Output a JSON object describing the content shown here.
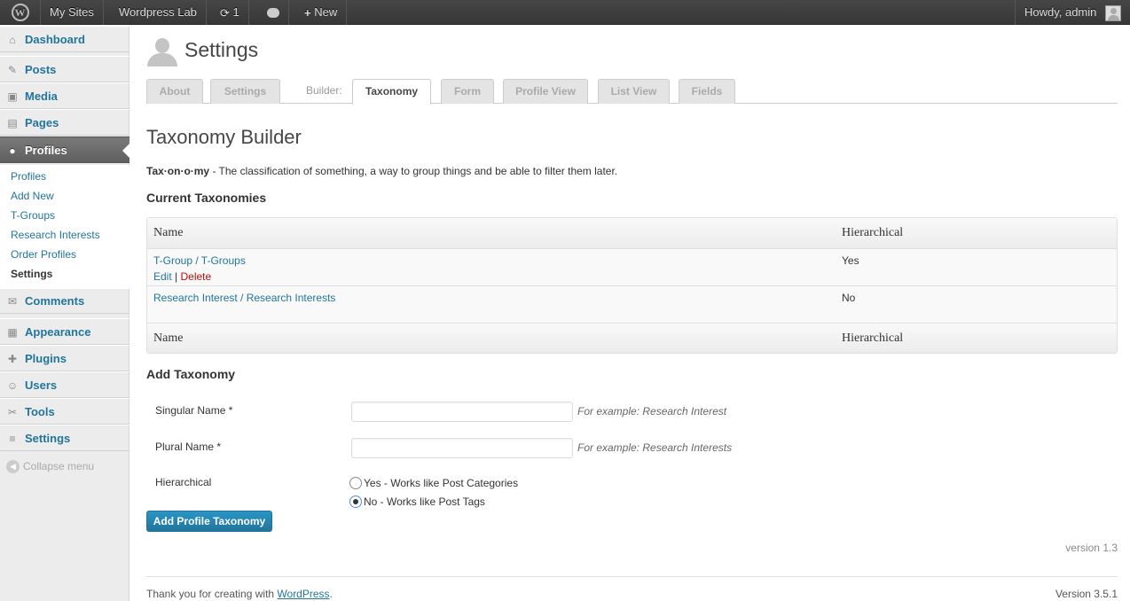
{
  "adminbar": {
    "logo": "W",
    "my_sites": "My Sites",
    "site_name": "Wordpress Lab",
    "updates_count": "1",
    "new_label": "New",
    "howdy": "Howdy, admin"
  },
  "sidebar": {
    "items": [
      {
        "label": "Dashboard",
        "icon": "⌂"
      },
      {
        "label": "Posts",
        "icon": "✎"
      },
      {
        "label": "Media",
        "icon": "▣"
      },
      {
        "label": "Pages",
        "icon": "▤"
      },
      {
        "label": "Profiles",
        "icon": "●"
      },
      {
        "label": "Comments",
        "icon": "✉"
      },
      {
        "label": "Appearance",
        "icon": "▦"
      },
      {
        "label": "Plugins",
        "icon": "✚"
      },
      {
        "label": "Users",
        "icon": "☺"
      },
      {
        "label": "Tools",
        "icon": "✂"
      },
      {
        "label": "Settings",
        "icon": "≡"
      }
    ],
    "submenu": [
      "Profiles",
      "Add New",
      "T-Groups",
      "Research Interests",
      "Order Profiles",
      "Settings"
    ],
    "collapse": "Collapse menu"
  },
  "page": {
    "title": "Settings",
    "tabs": [
      "About",
      "Settings",
      "Taxonomy",
      "Form",
      "Profile View",
      "List View",
      "Fields"
    ],
    "builder_label": "Builder:",
    "heading": "Taxonomy Builder",
    "definition_term": "Tax·on·o·my",
    "definition_text": " - The classification of something, a way to group things and be able to filter them later.",
    "current_heading": "Current Taxonomies",
    "table": {
      "col_name": "Name",
      "col_hier": "Hierarchical",
      "rows": [
        {
          "name": "T-Group / T-Groups",
          "hier": "Yes",
          "edit": "Edit",
          "sep": " | ",
          "delete": "Delete"
        },
        {
          "name": "Research Interest / Research Interests",
          "hier": "No"
        }
      ]
    },
    "add_heading": "Add Taxonomy",
    "form": {
      "singular_label": "Singular Name *",
      "singular_value": "",
      "singular_hint": "For example: Research Interest",
      "plural_label": "Plural Name *",
      "plural_value": "",
      "plural_hint": "For example: Research Interests",
      "hier_label": "Hierarchical",
      "hier_yes": "Yes - Works like Post Categories",
      "hier_no": "No - Works like Post Tags",
      "hier_selected": "No"
    },
    "submit": "Add Profile Taxonomy",
    "plugin_version": "version 1.3"
  },
  "footer": {
    "thanks_prefix": "Thank you for creating with ",
    "thanks_link": "WordPress",
    "thanks_suffix": ".",
    "version": "Version 3.5.1"
  },
  "colors": {
    "link": "#21759b",
    "delete": "#bc0b0b",
    "button": "#21759b"
  }
}
